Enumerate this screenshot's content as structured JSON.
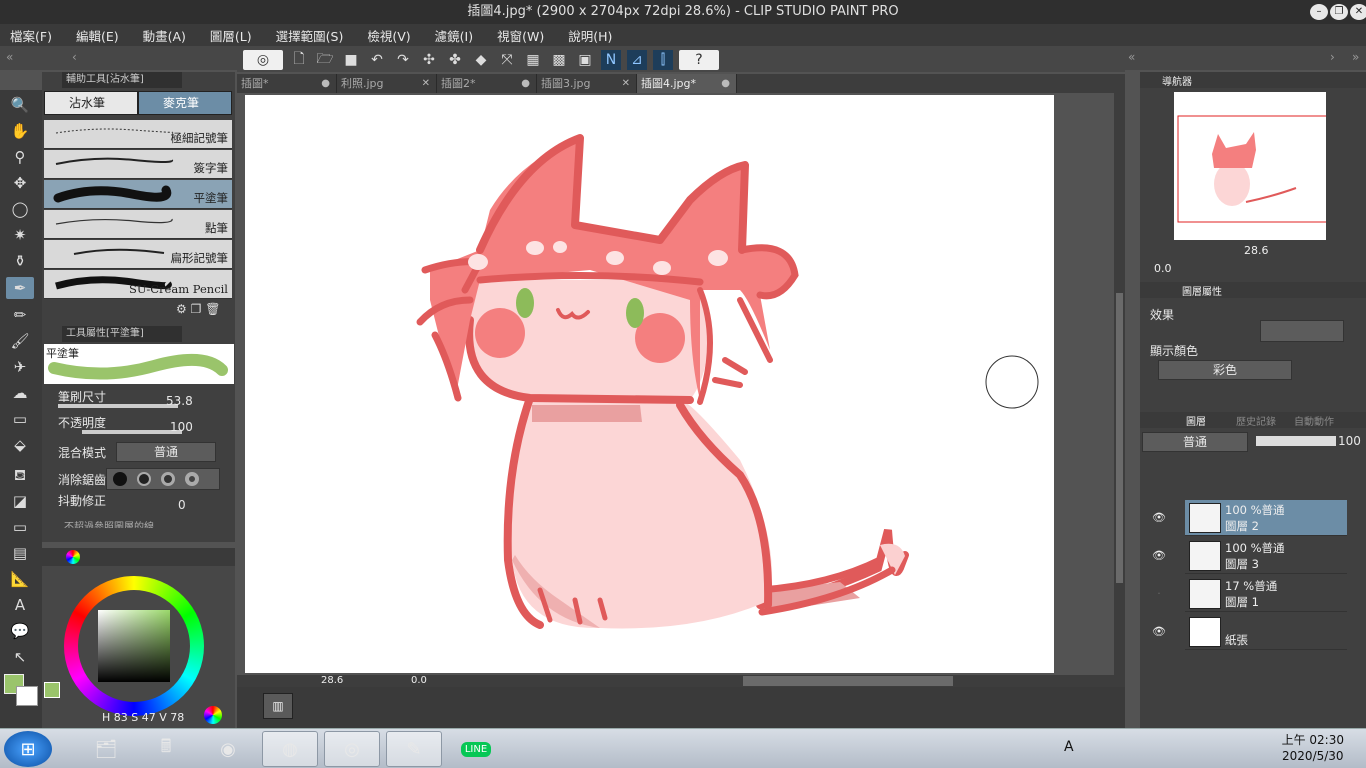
{
  "window": {
    "title": "插圖4.jpg* (2900 x 2704px 72dpi 28.6%) - CLIP STUDIO PAINT PRO"
  },
  "menu": [
    "檔案(F)",
    "編輯(E)",
    "動畫(A)",
    "圖層(L)",
    "選擇範圍(S)",
    "檢視(V)",
    "濾鏡(I)",
    "視窗(W)",
    "說明(H)"
  ],
  "tabs": [
    {
      "label": "插圖*",
      "active": false
    },
    {
      "label": "利照.jpg",
      "active": false
    },
    {
      "label": "插圖2*",
      "active": false
    },
    {
      "label": "插圖3.jpg",
      "active": false
    },
    {
      "label": "插圖4.jpg*",
      "active": true
    }
  ],
  "subtool": {
    "title": "輔助工具[沾水筆]",
    "tabs": [
      "沾水筆",
      "麥克筆"
    ],
    "brushes": [
      "極細記號筆",
      "簽字筆",
      "平塗筆",
      "點筆",
      "扁形記號筆",
      "SU-Cream Pencil"
    ],
    "selected_brush": "平塗筆"
  },
  "toolprops": {
    "title": "工具屬性[平塗筆]",
    "preview_label": "平塗筆",
    "size_label": "筆刷尺寸",
    "size_value": "53.8",
    "opacity_label": "不透明度",
    "opacity_value": "100",
    "blend_label": "混合模式",
    "blend_value": "普通",
    "aa_label": "消除鋸齒",
    "stab_label": "抖動修正",
    "stab_value": "0",
    "cut_label": "不超過參照圖層的線"
  },
  "color": {
    "h_label": "H",
    "h_value": "83",
    "s_label": "S",
    "s_value": "47",
    "v_label": "V",
    "v_value": "78",
    "main": "#9ac46b"
  },
  "navigator": {
    "title": "導航器",
    "zoom": "28.6",
    "rotate": "0.0"
  },
  "layerprops": {
    "title": "圖層屬性",
    "effect_label": "效果",
    "display_label": "顯示顏色",
    "display_value": "彩色"
  },
  "layerpanel": {
    "tabs": [
      "圖層",
      "歷史記錄",
      "自動動作"
    ],
    "blend": "普通",
    "opacity": "100",
    "layers": [
      {
        "line1": "100 %普通",
        "line2": "圖層 2",
        "visible": true,
        "selected": true
      },
      {
        "line1": "100 %普通",
        "line2": "圖層 3",
        "visible": true,
        "selected": false
      },
      {
        "line1": "17 %普通",
        "line2": "圖層 1",
        "visible": false,
        "selected": false
      },
      {
        "line1": "",
        "line2": "紙張",
        "visible": true,
        "selected": false
      }
    ]
  },
  "statusbar": {
    "zoom": "28.6",
    "rotate": "0.0"
  },
  "taskbar": {
    "time": "上午 02:30",
    "date": "2020/5/30",
    "lang": "A",
    "apps": [
      "start",
      "explorer",
      "calculator",
      "paint-app",
      "chrome",
      "clip-studio",
      "clip-studio-paint",
      "line"
    ]
  }
}
